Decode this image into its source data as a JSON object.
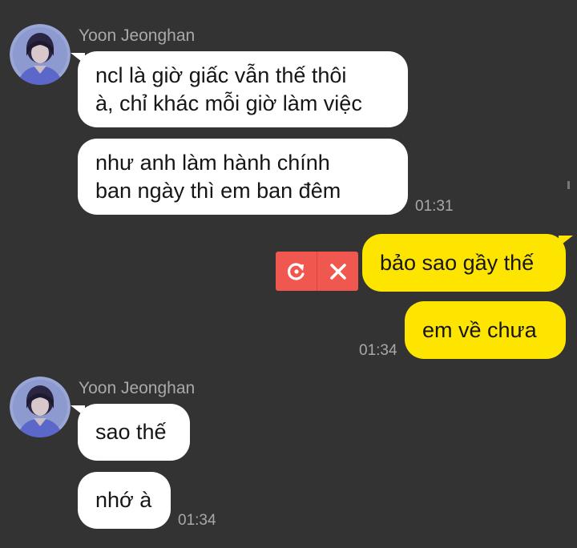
{
  "chat": {
    "groups": [
      {
        "sender": "Yoon Jeonghan",
        "messages": [
          {
            "lines": [
              "ncl là giờ giấc vẫn thế thôi",
              "à, chỉ khác mỗi giờ làm việc"
            ]
          },
          {
            "lines": [
              "như anh làm hành chính",
              "ban ngày thì em ban đêm"
            ],
            "time": "01:31"
          }
        ]
      },
      {
        "sender": "Yoon Jeonghan",
        "messages": [
          {
            "lines": [
              "sao thế"
            ]
          },
          {
            "lines": [
              "nhớ à"
            ],
            "time": "01:34"
          }
        ]
      }
    ],
    "outgoing": [
      {
        "text": "bảo sao gầy thế",
        "status": "failed"
      },
      {
        "text": "em về chưa",
        "time": "01:34"
      }
    ],
    "failed_actions": {
      "retry_icon": "retry-icon",
      "delete_icon": "close-icon"
    }
  },
  "colors": {
    "background": "#333333",
    "incoming_bubble": "#ffffff",
    "outgoing_bubble": "#fee500",
    "failed_badge": "#f0584f",
    "meta_text": "#a9a9a9"
  }
}
